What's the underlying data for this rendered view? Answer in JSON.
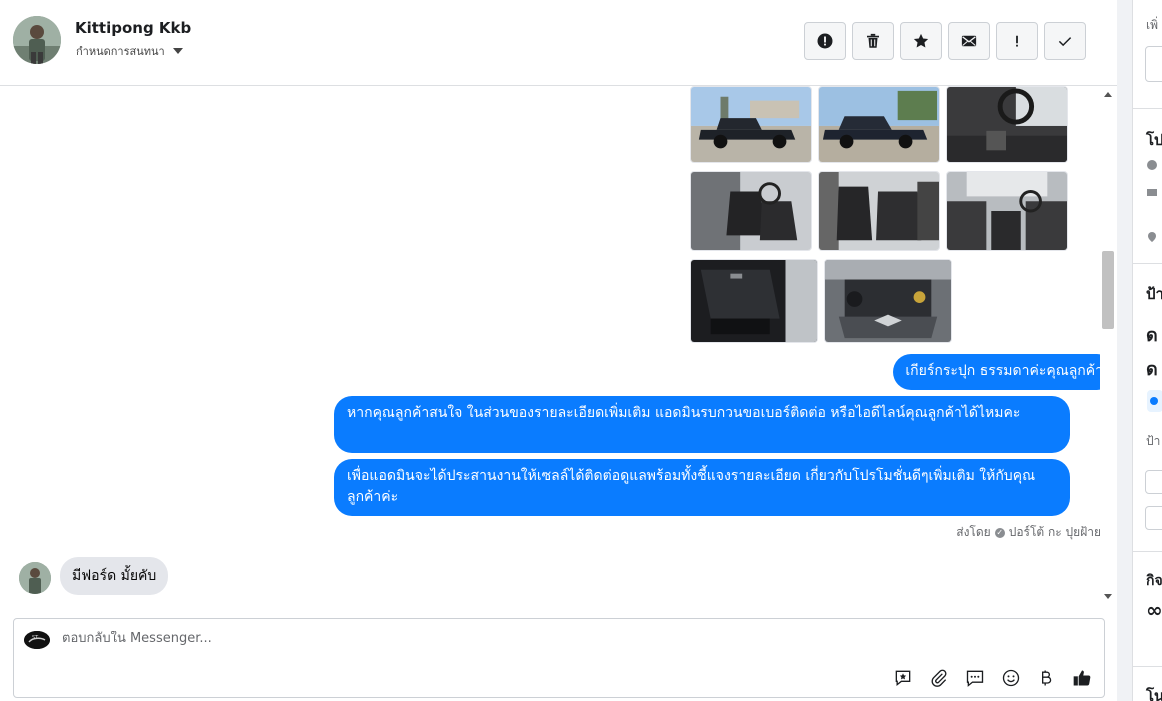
{
  "header": {
    "contact_name": "Kittipong Kkb",
    "assign_label": "กำหนดการสนทนา",
    "buttons": [
      {
        "name": "spam-button",
        "icon": "alert-circle-icon"
      },
      {
        "name": "delete-button",
        "icon": "trash-icon"
      },
      {
        "name": "star-button",
        "icon": "star-icon"
      },
      {
        "name": "mark-unread-button",
        "icon": "envelope-icon"
      },
      {
        "name": "follow-up-button",
        "icon": "exclamation-icon"
      },
      {
        "name": "mark-done-button",
        "icon": "check-icon"
      }
    ]
  },
  "messages": {
    "outgoing": [
      "เกียร์กระปุก ธรรมดาค่ะคุณลูกค้า",
      "หากคุณลูกค้าสนใจ ในส่วนของรายละเอียดเพิ่มเติม แอดมินรบกวนขอเบอร์ติดต่อ หรือไอดีไลน์คุณลูกค้าได้ไหมคะ",
      "เพื่อแอดมินจะได้ประสานงานให้เซลล์ได้ติดต่อดูแลพร้อมทั้งชี้แจงรายละเอียด เกี่ยวกับโปรโมชั่นดีๆเพิ่มเติม ให้กับคุณลูกค้าค่ะ"
    ],
    "sent_by_prefix": "ส่งโดย",
    "sent_by_name": "ปอร์โต้ กะ ปุยฝ้าย",
    "incoming": "มีฟอร์ด มั้ยคับ"
  },
  "composer": {
    "placeholder": "ตอบกลับใน Messenger..."
  },
  "sidebar": {
    "partial_labels": [
      "เพิ่",
      "โป",
      "ป้า",
      "ป้า",
      "กิจ",
      "โน"
    ]
  },
  "colors": {
    "accent": "#0a7cff",
    "incoming_bubble": "#e4e6eb",
    "border": "#dddfe2"
  }
}
